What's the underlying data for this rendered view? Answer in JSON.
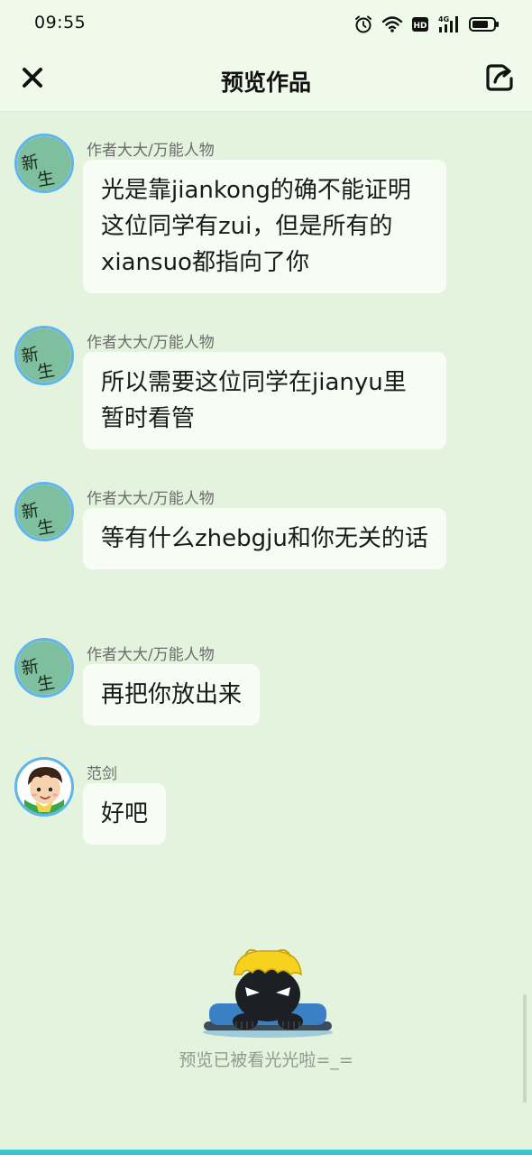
{
  "status_bar": {
    "time": "09:55",
    "hd_label": "HD",
    "network_label": "4G",
    "icons": [
      "alarm-icon",
      "wifi-icon",
      "hd-icon",
      "signal-4g-icon",
      "battery-icon"
    ]
  },
  "header": {
    "title": "预览作品",
    "close_icon": "close-icon",
    "share_icon": "share-icon"
  },
  "messages": [
    {
      "sender": "作者大大/万能人物",
      "text": "光是靠jiankong的确不能证明这位同学有zui，但是所有的xiansuo都指向了你",
      "avatar": "新生-avatar"
    },
    {
      "sender": "作者大大/万能人物",
      "text": "所以需要这位同学在jianyu里暂时看管",
      "avatar": "新生-avatar"
    },
    {
      "sender": "作者大大/万能人物",
      "text": "等有什么zhebgju和你无关的话",
      "avatar": "新生-avatar"
    },
    {
      "sender": "作者大大/万能人物",
      "text": "再把你放出来",
      "avatar": "新生-avatar"
    },
    {
      "sender": "范剑",
      "text": "好吧",
      "avatar": "boy-avatar"
    }
  ],
  "end_of_preview": {
    "text": "预览已被看光光啦=_=",
    "mascot": "peeking-mascot"
  },
  "colors": {
    "background": "#e4f3de",
    "header_bg": "#effaea",
    "bubble_bg": "#f7fcf4",
    "avatar_border": "#5fb4ec",
    "avatar_green": "#7dbf9e",
    "accent_strip": "#3fc4cf"
  }
}
